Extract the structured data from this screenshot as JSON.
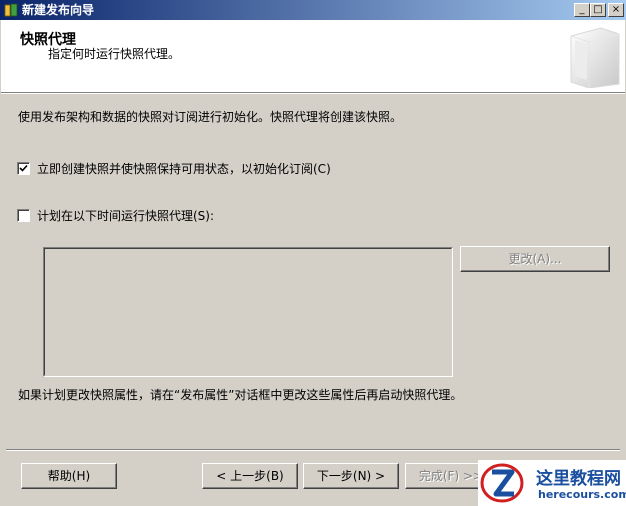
{
  "window": {
    "title": "新建发布向导",
    "minimize_glyph": "_",
    "maximize_glyph": "□",
    "close_glyph": "×"
  },
  "header": {
    "title": "快照代理",
    "subtitle": "指定何时运行快照代理。"
  },
  "body": {
    "description": "使用发布架构和数据的快照对订阅进行初始化。快照代理将创建该快照。",
    "create_snapshot_checkbox": {
      "label": "立即创建快照并使快照保持可用状态，以初始化订阅(C)",
      "checked": true
    },
    "schedule_checkbox": {
      "label": "计划在以下时间运行快照代理(S):",
      "checked": false
    },
    "change_button": "更改(A)...",
    "note": "如果计划更改快照属性，请在“发布属性”对话框中更改这些属性后再启动快照代理。"
  },
  "footer": {
    "help_button": "帮助(H)",
    "back_button": "< 上一步(B)",
    "next_button": "下一步(N) >",
    "finish_button": "完成(F) >>|"
  },
  "watermark": {
    "title": "这里教程网",
    "url": "herecours.com"
  }
}
